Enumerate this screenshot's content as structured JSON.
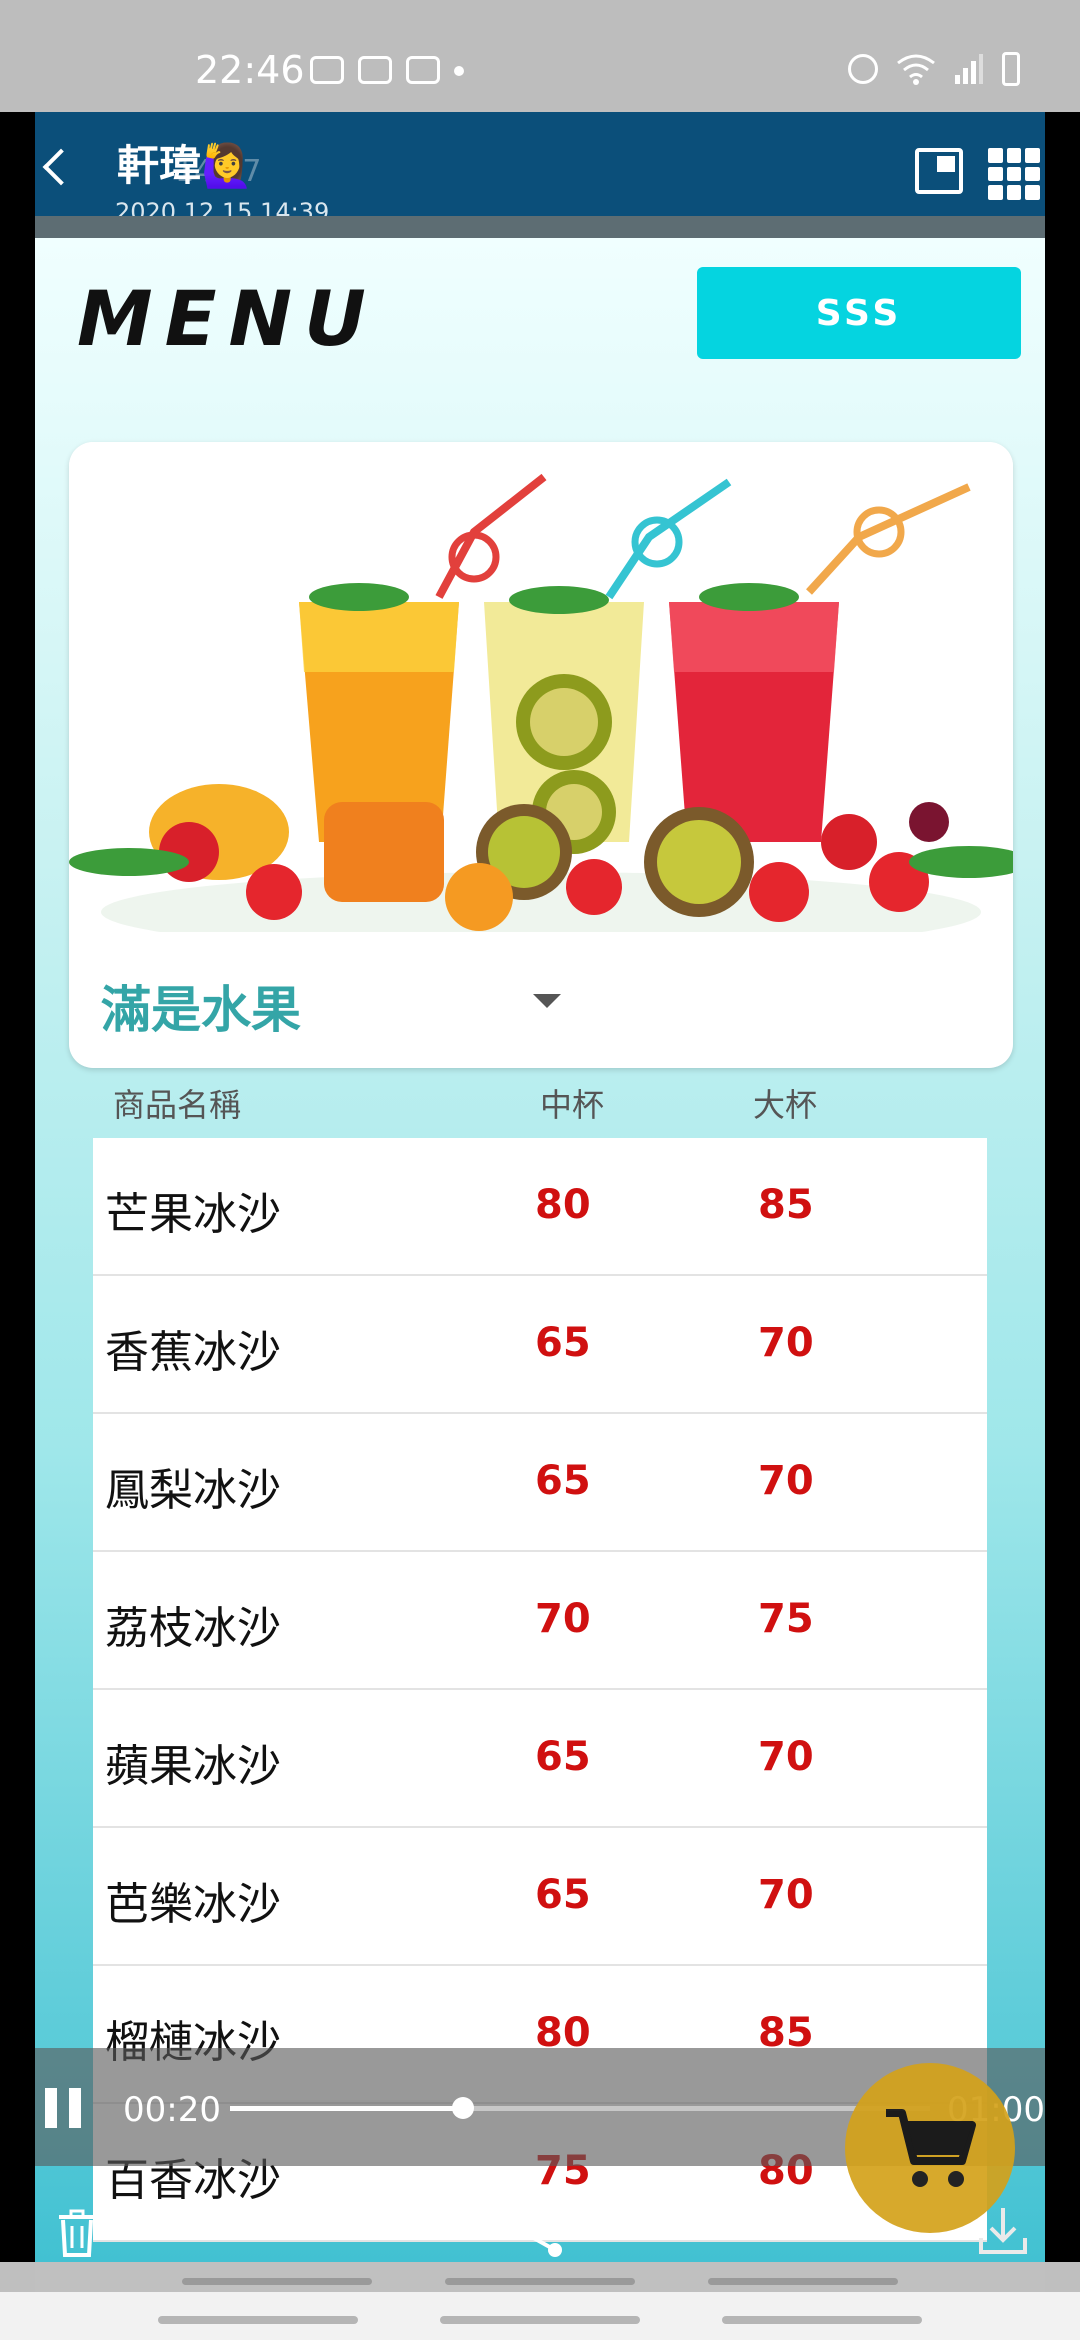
{
  "status_bar": {
    "time": "22:46"
  },
  "chat_header": {
    "name": "軒瑋🙋‍♀️",
    "datetime": "2020.12.15 14:39",
    "ghost_time": "14:37"
  },
  "menu": {
    "title": "MENU",
    "sss_label": "SSS",
    "category_selected": "滿是水果",
    "columns": {
      "name": "商品名稱",
      "medium": "中杯",
      "large": "大杯"
    },
    "items": [
      {
        "name": "芒果冰沙",
        "medium": "80",
        "large": "85"
      },
      {
        "name": "香蕉冰沙",
        "medium": "65",
        "large": "70"
      },
      {
        "name": "鳳梨冰沙",
        "medium": "65",
        "large": "70"
      },
      {
        "name": "荔枝冰沙",
        "medium": "70",
        "large": "75"
      },
      {
        "name": "蘋果冰沙",
        "medium": "65",
        "large": "70"
      },
      {
        "name": "芭樂冰沙",
        "medium": "65",
        "large": "70"
      },
      {
        "name": "榴槤冰沙",
        "medium": "80",
        "large": "85"
      },
      {
        "name": "百香冰沙",
        "medium": "75",
        "large": "80"
      }
    ]
  },
  "player": {
    "current_time": "00:20",
    "total_time": "01:00",
    "progress": 0.3333
  },
  "colors": {
    "header": "#0b4f7a",
    "accent": "#05d4e0",
    "price": "#d01010",
    "category": "#34a5a7",
    "cart": "#d4a21b"
  }
}
